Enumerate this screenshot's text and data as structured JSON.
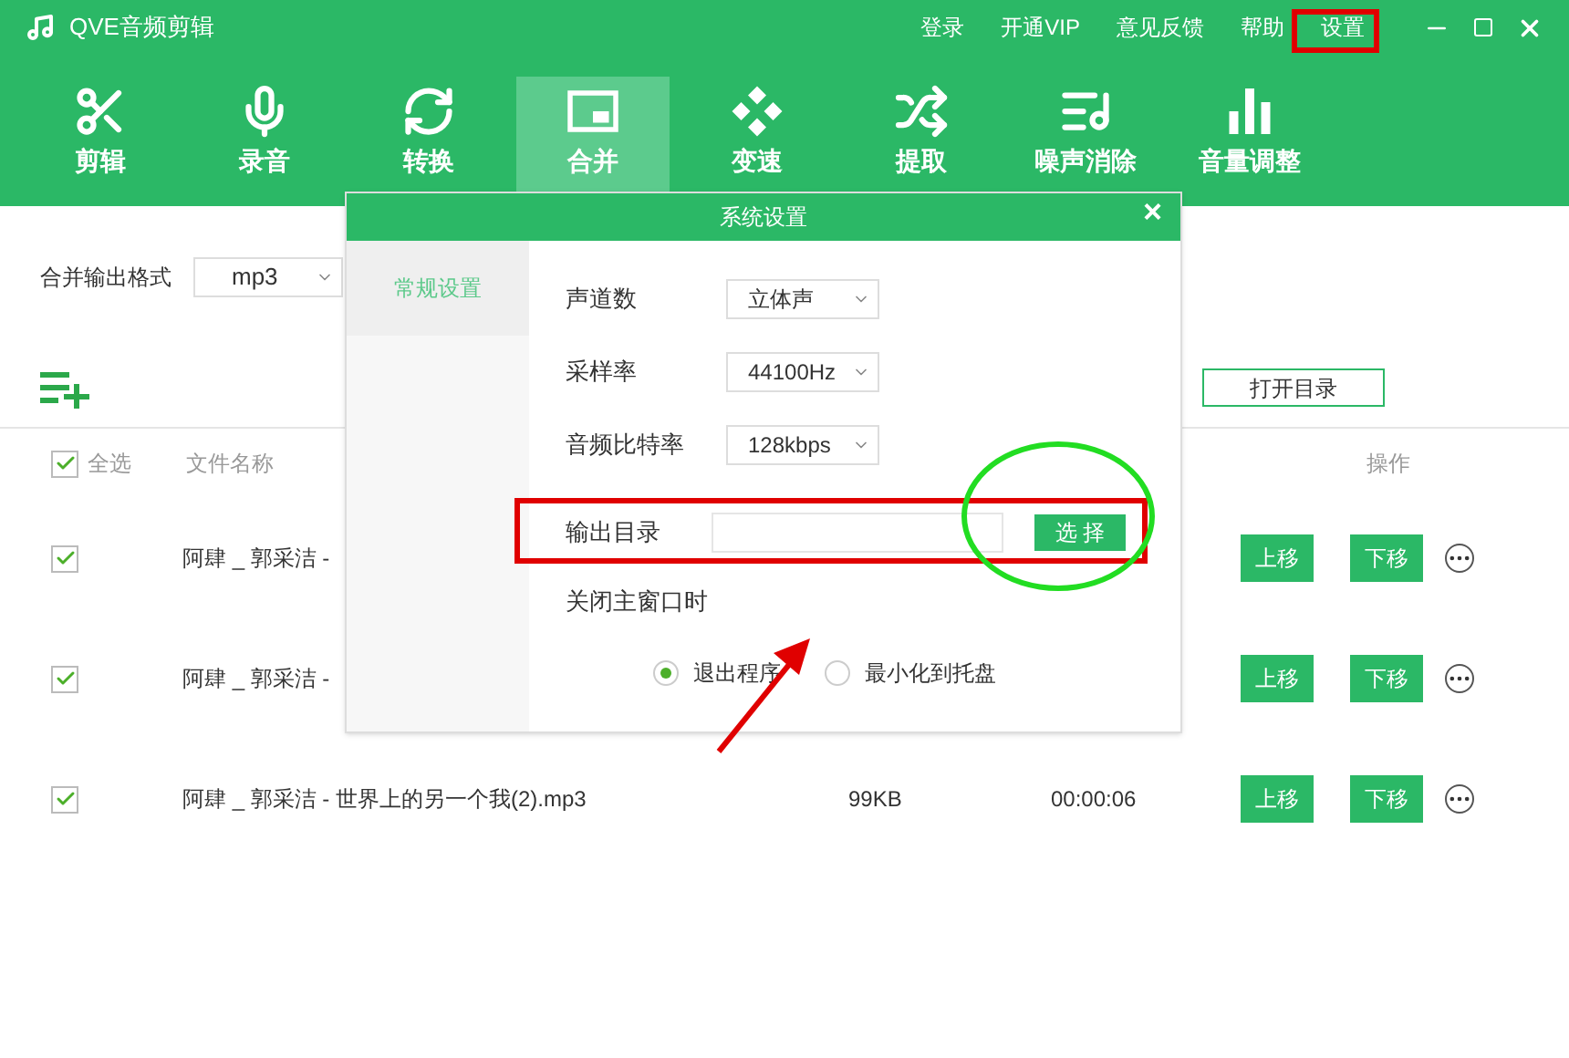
{
  "window": {
    "title": "QVE音频剪辑",
    "menu": [
      "登录",
      "开通VIP",
      "意见反馈",
      "帮助",
      "设置"
    ]
  },
  "toolbar": [
    {
      "label": "剪辑",
      "selected": false
    },
    {
      "label": "录音",
      "selected": false
    },
    {
      "label": "转换",
      "selected": false
    },
    {
      "label": "合并",
      "selected": true
    },
    {
      "label": "变速",
      "selected": false
    },
    {
      "label": "提取",
      "selected": false
    },
    {
      "label": "噪声消除",
      "selected": false
    },
    {
      "label": "音量调整",
      "selected": false
    }
  ],
  "format": {
    "label": "合并输出格式",
    "value": "mp3"
  },
  "open_dir_button": "打开目录",
  "table": {
    "select_all": {
      "label": "全选",
      "checked": true
    },
    "columns": [
      "文件名称",
      "操作"
    ],
    "rows": [
      {
        "checked": true,
        "name": "阿肆 _ 郭采洁 -",
        "size": "",
        "duration": "",
        "up": "上移",
        "down": "下移"
      },
      {
        "checked": true,
        "name": "阿肆 _ 郭采洁 -",
        "size": "",
        "duration": "",
        "up": "上移",
        "down": "下移"
      },
      {
        "checked": true,
        "name": "阿肆 _ 郭采洁 - 世界上的另一个我(2).mp3",
        "size": "99KB",
        "duration": "00:00:06",
        "up": "上移",
        "down": "下移"
      }
    ]
  },
  "dialog": {
    "title": "系统设置",
    "close": "×",
    "tabs": [
      {
        "label": "常规设置",
        "selected": true
      }
    ],
    "selects": [
      {
        "label": "声道数",
        "value": "立体声"
      },
      {
        "label": "采样率",
        "value": "44100Hz"
      },
      {
        "label": "音频比特率",
        "value": "128kbps"
      }
    ],
    "output": {
      "label": "输出目录",
      "button": "选 择"
    },
    "close_label": "关闭主窗口时",
    "radios": [
      {
        "label": "退出程序",
        "selected": true
      },
      {
        "label": "最小化到托盘",
        "selected": false
      }
    ]
  }
}
